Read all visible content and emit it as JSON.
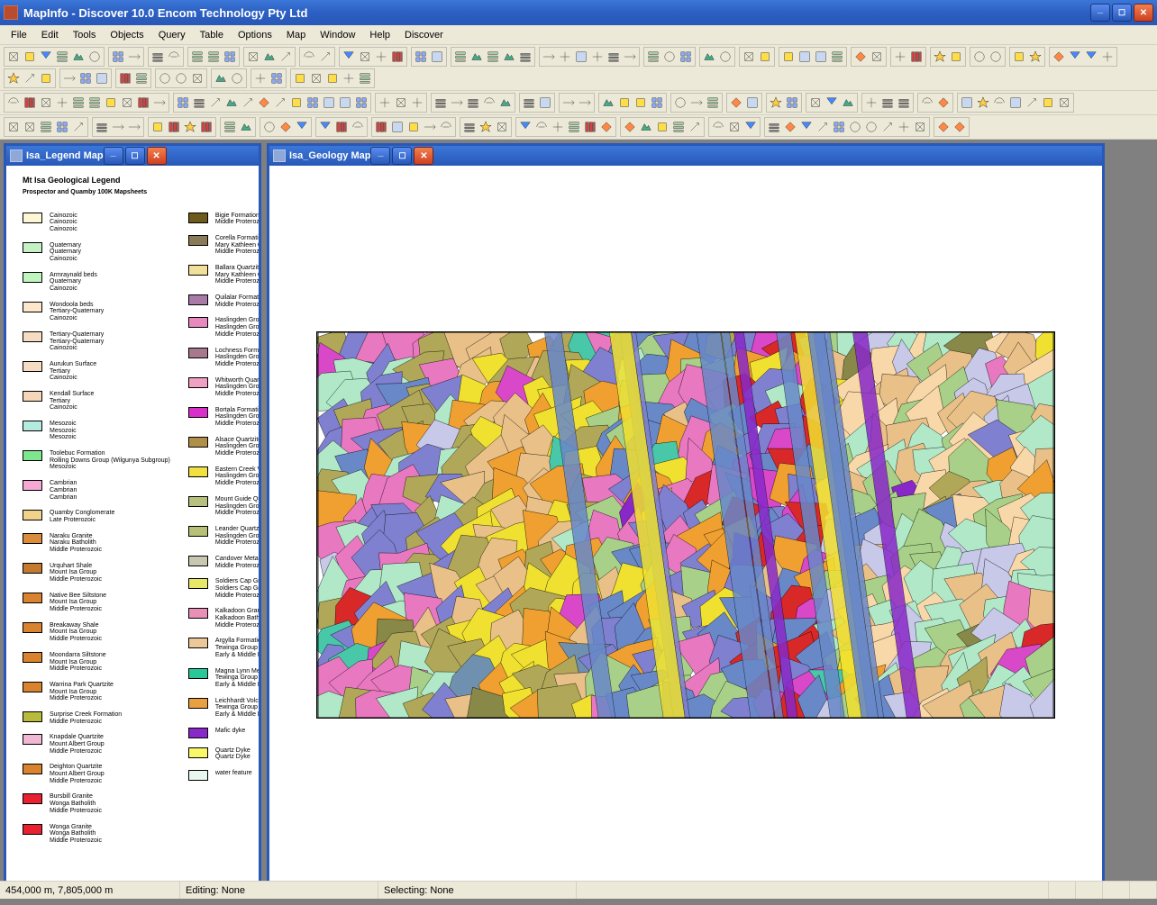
{
  "title": "MapInfo - Discover 10.0   Encom Technology Pty Ltd",
  "menu": [
    "File",
    "Edit",
    "Tools",
    "Objects",
    "Query",
    "Table",
    "Options",
    "Map",
    "Window",
    "Help",
    "Discover"
  ],
  "windows": {
    "legend": {
      "title": "Isa_Legend Map"
    },
    "geology": {
      "title": "Isa_Geology Map"
    }
  },
  "legend": {
    "title": "Mt Isa Geological Legend",
    "subtitle": "Prospector and Quamby 100K Mapsheets",
    "col1": [
      {
        "c": "#fdf7d6",
        "t": [
          "Cainozoic",
          "Cainozoic",
          "Cainozoic"
        ]
      },
      {
        "c": "#c6f0c6",
        "t": [
          "Quaternary",
          "Quaternary",
          "Cainozoic"
        ]
      },
      {
        "c": "#c0f5c0",
        "t": [
          "Armraynald beds",
          "Quaternary",
          "Cainozoic"
        ]
      },
      {
        "c": "#fce6cc",
        "t": [
          "Wondoola beds",
          "Tertiary-Quaternary",
          "Cainozoic"
        ]
      },
      {
        "c": "#f5dcc2",
        "t": [
          "Tertiary-Quaternary",
          "Tertiary-Quaternary",
          "Cainozoic"
        ]
      },
      {
        "c": "#f5dcc2",
        "t": [
          "Aurukun Surface",
          "Tertiary",
          "Cainozoic"
        ]
      },
      {
        "c": "#f5d6b8",
        "t": [
          "Kendall Surface",
          "Tertiary",
          "Cainozoic"
        ]
      },
      {
        "c": "#b3ecdf",
        "t": [
          "Mesozoic",
          "Mesozoic",
          "Mesozoic"
        ]
      },
      {
        "c": "#7de68e",
        "t": [
          "Toolebuc Formation",
          "Rolling Downs Group (Wilgunya Subgroup)",
          "Mesozoic"
        ]
      },
      {
        "c": "#f5a8d4",
        "t": [
          "Cambrian",
          "Cambrian",
          "Cambrian"
        ]
      },
      {
        "c": "#f0d28a",
        "t": [
          "Quamby Conglomerate",
          "",
          "Late Proterozoic"
        ]
      },
      {
        "c": "#d98c3c",
        "t": [
          "Naraku Granite",
          "Naraku Batholith",
          "Middle Proterozoic"
        ]
      },
      {
        "c": "#c47a2e",
        "t": [
          "Urquhart Shale",
          "Mount Isa Group",
          "Middle Proterozoic"
        ]
      },
      {
        "c": "#d9832e",
        "t": [
          "Native Bee Siltstone",
          "Mount Isa Group",
          "Middle Proterozoic"
        ]
      },
      {
        "c": "#d9832e",
        "t": [
          "Breakaway Shale",
          "Mount Isa Group",
          "Middle Proterozoic"
        ]
      },
      {
        "c": "#d9832e",
        "t": [
          "Moondarra Siltstone",
          "Mount Isa Group",
          "Middle Proterozoic"
        ]
      },
      {
        "c": "#d9832e",
        "t": [
          "Warrina Park Quartzite",
          "Mount Isa Group",
          "Middle Proterozoic"
        ]
      },
      {
        "c": "#b8ba3c",
        "t": [
          "Surprise Creek Formation",
          "",
          "Middle Proterozoic"
        ]
      },
      {
        "c": "#f0b8d4",
        "t": [
          "Knapdale Quartzite",
          "Mount Albert Group",
          "Middle Proterozoic"
        ]
      },
      {
        "c": "#d9832e",
        "t": [
          "Deighton Quartzite",
          "Mount Albert Group",
          "Middle Proterozoic"
        ]
      },
      {
        "c": "#e82030",
        "t": [
          "Bursbill Granite",
          "Wonga Batholith",
          "Middle Proterozoic"
        ]
      },
      {
        "c": "#e82030",
        "t": [
          "Wonga Granite",
          "Wonga Batholith",
          "Middle Proterozoic"
        ]
      }
    ],
    "col2": [
      {
        "c": "#6e5a1a",
        "t": [
          "Bigie Formation",
          "",
          "Middle Proterozoic"
        ]
      },
      {
        "c": "#8a7a58",
        "t": [
          "Corella Formation",
          "Mary Kathleen Group",
          "Middle Proterozoic"
        ]
      },
      {
        "c": "#f0e09a",
        "t": [
          "Ballara Quartzite",
          "Mary Kathleen Group",
          "Middle Proterozoic"
        ]
      },
      {
        "c": "#a87aa8",
        "t": [
          "Quilalar Formation",
          "",
          "Middle Proterozoic"
        ]
      },
      {
        "c": "#e88ac0",
        "t": [
          "Haslingden Group (Myally Subgroup)",
          "Haslingden Group (Myally Subgroup)",
          "Middle Proterozoic"
        ]
      },
      {
        "c": "#a8788c",
        "t": [
          "Lochness Formation",
          "Haslingden Group (Myally Subgroup)",
          "Middle Proterozoic"
        ]
      },
      {
        "c": "#f0a0c0",
        "t": [
          "Whitworth Quartzite",
          "Haslingden Group (Myally Subgroup)",
          "Middle Proterozoic"
        ]
      },
      {
        "c": "#d830c8",
        "t": [
          "Bortala Formation",
          "Haslingden Group (Myally Subgroup)",
          "Middle Proterozoic"
        ]
      },
      {
        "c": "#b09048",
        "t": [
          "Alsace Quartzite",
          "Haslingden Group (Myally Subgroup)",
          "Middle Proterozoic"
        ]
      },
      {
        "c": "#f0e040",
        "t": [
          "Eastern Creek Volcanics",
          "Haslingden Group",
          "Middle Proterozoic"
        ]
      },
      {
        "c": "#b8c080",
        "t": [
          "Mount Guide Quartzite",
          "Haslingden Group",
          "Middle Proterozoic"
        ]
      },
      {
        "c": "#b8c078",
        "t": [
          "Leander Quartzite",
          "Haslingden Group",
          "Middle Proterozoic"
        ]
      },
      {
        "c": "#c8c8b0",
        "t": [
          "Candover Metamorphics",
          "",
          "Middle Proterozoic"
        ]
      },
      {
        "c": "#e8e868",
        "t": [
          "Soldiers Cap Group",
          "Soldiers Cap Group",
          "Middle Proterozoic"
        ]
      },
      {
        "c": "#e890b8",
        "t": [
          "Kalkadoon Granite",
          "Kalkadoon Batholith",
          "Middle Proterozoic"
        ]
      },
      {
        "c": "#ecc898",
        "t": [
          "Argylla Formation",
          "Tewinga Group",
          "Early & Middle Proterozoic"
        ]
      },
      {
        "c": "#28c898",
        "t": [
          "Magna Lynn Metabasalt",
          "Tewinga Group",
          "Early & Middle Proterozoic"
        ]
      },
      {
        "c": "#e8a040",
        "t": [
          "Leichhardt Volcanics",
          "Tewinga Group",
          "Early & Middle Proterozoic"
        ]
      },
      {
        "c": "#8828c8",
        "t": [
          "Mafic dyke",
          "",
          ""
        ]
      },
      {
        "c": "#f8f868",
        "t": [
          "Quartz Dyke",
          "Quartz Dyke",
          ""
        ]
      },
      {
        "c": "#e8f8f0",
        "t": [
          "water feature",
          "",
          ""
        ]
      }
    ]
  },
  "status": {
    "coords": "454,000 m, 7,805,000 m",
    "editing": "Editing: None",
    "selecting": "Selecting: None"
  }
}
